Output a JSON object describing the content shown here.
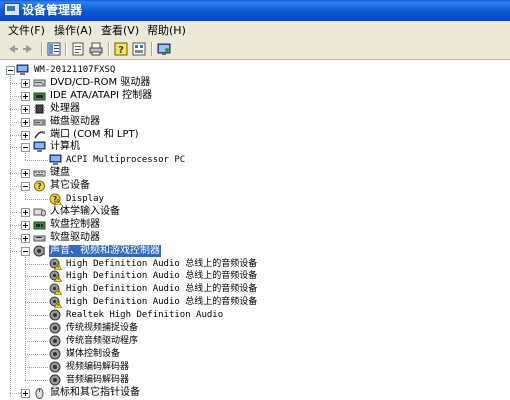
{
  "window": {
    "title": "设备管理器"
  },
  "menu": [
    {
      "label": "文件(F)"
    },
    {
      "label": "操作(A)"
    },
    {
      "label": "查看(V)"
    },
    {
      "label": "帮助(H)"
    }
  ],
  "toolbar": {
    "buttons": [
      "back-icon",
      "forward-icon",
      "tree-view-icon",
      "properties-icon",
      "print-icon",
      "help-icon",
      "device-list-icon",
      "scan-hardware-icon"
    ]
  },
  "tree": {
    "root": "WM-20121107FXSQ",
    "items": [
      {
        "label": "DVD/CD-ROM 驱动器",
        "icon": "cdrom-icon",
        "level": 1,
        "state": "collapsed"
      },
      {
        "label": "IDE ATA/ATAPI 控制器",
        "icon": "ide-controller-icon",
        "level": 1,
        "state": "collapsed"
      },
      {
        "label": "处理器",
        "icon": "processor-icon",
        "level": 1,
        "state": "collapsed"
      },
      {
        "label": "磁盘驱动器",
        "icon": "disk-drive-icon",
        "level": 1,
        "state": "collapsed"
      },
      {
        "label": "端口 (COM 和 LPT)",
        "icon": "port-icon",
        "level": 1,
        "state": "collapsed"
      },
      {
        "label": "计算机",
        "icon": "computer-icon",
        "level": 1,
        "state": "expanded"
      },
      {
        "label": "ACPI Multiprocessor PC",
        "icon": "computer-icon",
        "level": 2
      },
      {
        "label": "键盘",
        "icon": "keyboard-icon",
        "level": 1,
        "state": "collapsed"
      },
      {
        "label": "其它设备",
        "icon": "unknown-device-icon",
        "level": 1,
        "state": "expanded"
      },
      {
        "label": "Display",
        "icon": "unknown-device-warning-icon",
        "level": 2
      },
      {
        "label": "人体学输入设备",
        "icon": "hid-icon",
        "level": 1,
        "state": "collapsed"
      },
      {
        "label": "软盘控制器",
        "icon": "floppy-controller-icon",
        "level": 1,
        "state": "collapsed"
      },
      {
        "label": "软盘驱动器",
        "icon": "floppy-drive-icon",
        "level": 1,
        "state": "collapsed"
      },
      {
        "label": "声音、视频和游戏控制器",
        "icon": "sound-video-game-icon",
        "level": 1,
        "state": "expanded",
        "selected": true
      },
      {
        "label": "High Definition Audio 总线上的音频设备",
        "icon": "audio-warning-icon",
        "level": 2
      },
      {
        "label": "High Definition Audio 总线上的音频设备",
        "icon": "audio-warning-icon",
        "level": 2
      },
      {
        "label": "High Definition Audio 总线上的音频设备",
        "icon": "audio-warning-icon",
        "level": 2
      },
      {
        "label": "High Definition Audio 总线上的音频设备",
        "icon": "audio-warning-icon",
        "level": 2
      },
      {
        "label": "Realtek High Definition Audio",
        "icon": "audio-device-icon",
        "level": 2
      },
      {
        "label": "传统视频捕捉设备",
        "icon": "audio-device-icon",
        "level": 2
      },
      {
        "label": "传统音频驱动程序",
        "icon": "audio-device-icon",
        "level": 2
      },
      {
        "label": "媒体控制设备",
        "icon": "audio-device-icon",
        "level": 2
      },
      {
        "label": "视频编码解码器",
        "icon": "audio-device-icon",
        "level": 2
      },
      {
        "label": "音频编码解码器",
        "icon": "audio-device-icon",
        "level": 2
      },
      {
        "label": "鼠标和其它指针设备",
        "icon": "mouse-icon",
        "level": 1,
        "state": "collapsed"
      }
    ]
  },
  "colors": {
    "titlebar": "#0b57d0",
    "selection": "#316ac5",
    "chrome": "#ece9d8"
  }
}
